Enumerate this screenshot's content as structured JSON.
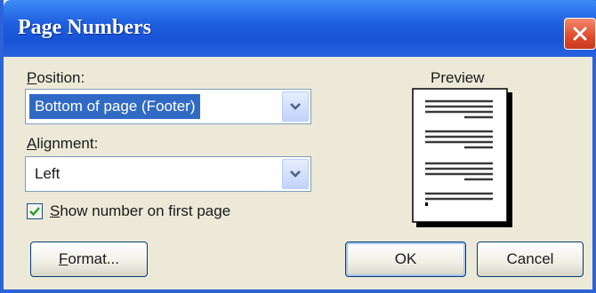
{
  "dialog": {
    "title": "Page Numbers",
    "close_icon": "close-icon"
  },
  "position": {
    "label": "Position:",
    "accel": "P",
    "label_rest": "osition:",
    "value": "Bottom of page (Footer)"
  },
  "alignment": {
    "label": "Alignment:",
    "accel": "A",
    "label_rest": "lignment:",
    "value": "Left"
  },
  "show_first": {
    "accel": "S",
    "label_rest": "how number on first page",
    "checked": true
  },
  "preview": {
    "label": "Preview"
  },
  "buttons": {
    "format_accel": "F",
    "format_rest": "ormat...",
    "ok": "OK",
    "cancel": "Cancel"
  },
  "colors": {
    "title_bar": "#1F5FE0",
    "selection": "#316AC5",
    "close_button": "#E0492A"
  }
}
